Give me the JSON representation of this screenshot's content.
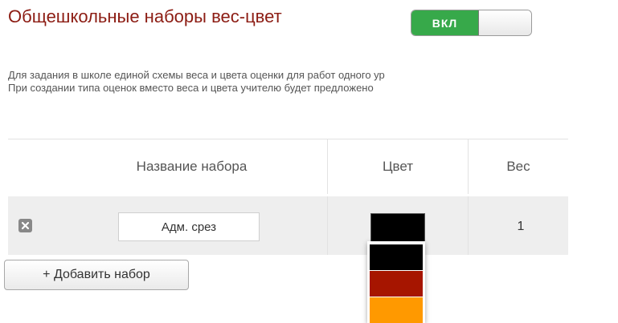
{
  "header": {
    "title": "Общешкольные наборы вес-цвет",
    "toggle_label": "ВКЛ"
  },
  "description": {
    "line1": "Для задания в школе единой схемы веса и цвета оценки для работ одного ур",
    "line2": "При создании типа оценок вместо веса и цвета учителю будет предложено"
  },
  "table": {
    "headers": {
      "name": "Название набора",
      "color": "Цвет",
      "weight": "Вес"
    },
    "rows": [
      {
        "name": "Адм. срез",
        "color": "#000000",
        "weight": "1"
      }
    ]
  },
  "add_button": "+ Добавить набор",
  "color_options": [
    "#000000",
    "#a61500",
    "#ff9900"
  ],
  "colors": {
    "title": "#8c1c13",
    "toggle_on": "#37a94a"
  }
}
